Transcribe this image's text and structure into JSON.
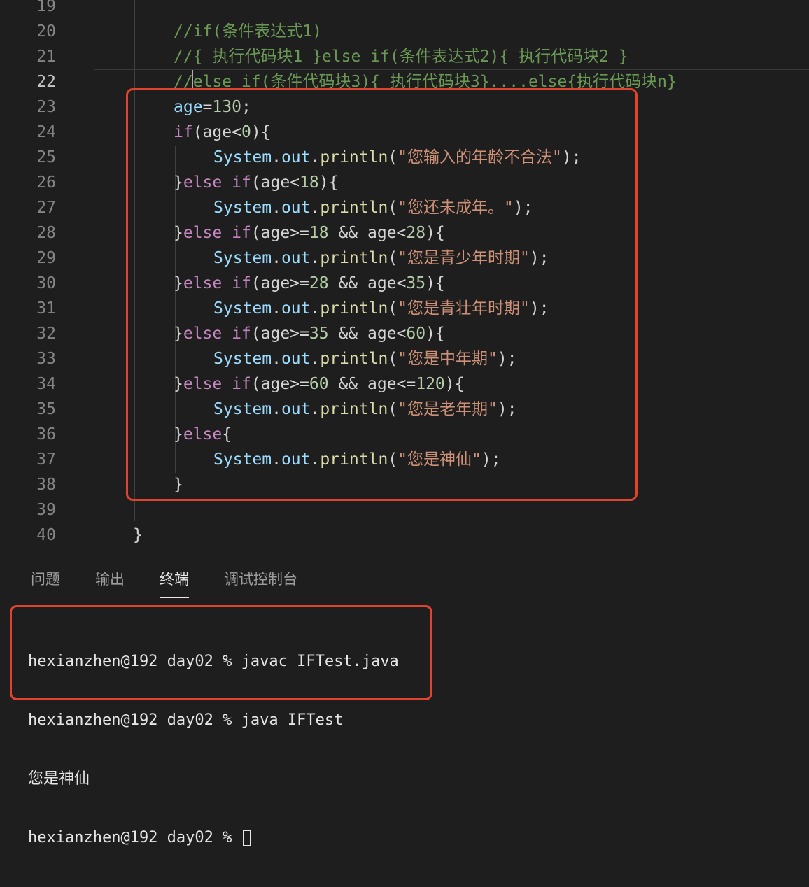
{
  "editor": {
    "lines": [
      {
        "num": "19",
        "segments": []
      },
      {
        "num": "20",
        "indent": 1,
        "segments": [
          {
            "t": "//if(条件表达式1)",
            "c": "cm"
          }
        ]
      },
      {
        "num": "21",
        "indent": 1,
        "segments": [
          {
            "t": "//{ 执行代码块1 }else if(条件表达式2){ 执行代码块2 }",
            "c": "cm"
          }
        ]
      },
      {
        "num": "22",
        "indent": 1,
        "current": true,
        "segments": [
          {
            "t": "//else if(条件代码块3){ 执行代码块3}....else{执行代码块n}",
            "c": "cm"
          }
        ]
      },
      {
        "num": "23",
        "indent": 1,
        "segments": [
          {
            "t": "age",
            "c": "var"
          },
          {
            "t": "=",
            "c": "op"
          },
          {
            "t": "130",
            "c": "num"
          },
          {
            "t": ";",
            "c": "op"
          }
        ]
      },
      {
        "num": "24",
        "indent": 1,
        "segments": [
          {
            "t": "if",
            "c": "kw"
          },
          {
            "t": "(age<",
            "c": "op"
          },
          {
            "t": "0",
            "c": "num"
          },
          {
            "t": "){",
            "c": "op"
          }
        ]
      },
      {
        "num": "25",
        "indent": 2,
        "segments": [
          {
            "t": "System",
            "c": "sys"
          },
          {
            "t": ".",
            "c": "op"
          },
          {
            "t": "out",
            "c": "sys"
          },
          {
            "t": ".",
            "c": "op"
          },
          {
            "t": "println",
            "c": "fn"
          },
          {
            "t": "(",
            "c": "op"
          },
          {
            "t": "\"您输入的年龄不合法\"",
            "c": "str"
          },
          {
            "t": ");",
            "c": "op"
          }
        ]
      },
      {
        "num": "26",
        "indent": 1,
        "segments": [
          {
            "t": "}",
            "c": "op"
          },
          {
            "t": "else if",
            "c": "kw"
          },
          {
            "t": "(age<",
            "c": "op"
          },
          {
            "t": "18",
            "c": "num"
          },
          {
            "t": "){",
            "c": "op"
          }
        ]
      },
      {
        "num": "27",
        "indent": 2,
        "segments": [
          {
            "t": "System",
            "c": "sys"
          },
          {
            "t": ".",
            "c": "op"
          },
          {
            "t": "out",
            "c": "sys"
          },
          {
            "t": ".",
            "c": "op"
          },
          {
            "t": "println",
            "c": "fn"
          },
          {
            "t": "(",
            "c": "op"
          },
          {
            "t": "\"您还未成年。\"",
            "c": "str"
          },
          {
            "t": ");",
            "c": "op"
          }
        ]
      },
      {
        "num": "28",
        "indent": 1,
        "segments": [
          {
            "t": "}",
            "c": "op"
          },
          {
            "t": "else if",
            "c": "kw"
          },
          {
            "t": "(age>=",
            "c": "op"
          },
          {
            "t": "18",
            "c": "num"
          },
          {
            "t": " && age<",
            "c": "op"
          },
          {
            "t": "28",
            "c": "num"
          },
          {
            "t": "){",
            "c": "op"
          }
        ]
      },
      {
        "num": "29",
        "indent": 2,
        "segments": [
          {
            "t": "System",
            "c": "sys"
          },
          {
            "t": ".",
            "c": "op"
          },
          {
            "t": "out",
            "c": "sys"
          },
          {
            "t": ".",
            "c": "op"
          },
          {
            "t": "println",
            "c": "fn"
          },
          {
            "t": "(",
            "c": "op"
          },
          {
            "t": "\"您是青少年时期\"",
            "c": "str"
          },
          {
            "t": ");",
            "c": "op"
          }
        ]
      },
      {
        "num": "30",
        "indent": 1,
        "segments": [
          {
            "t": "}",
            "c": "op"
          },
          {
            "t": "else if",
            "c": "kw"
          },
          {
            "t": "(age>=",
            "c": "op"
          },
          {
            "t": "28",
            "c": "num"
          },
          {
            "t": " && age<",
            "c": "op"
          },
          {
            "t": "35",
            "c": "num"
          },
          {
            "t": "){",
            "c": "op"
          }
        ]
      },
      {
        "num": "31",
        "indent": 2,
        "segments": [
          {
            "t": "System",
            "c": "sys"
          },
          {
            "t": ".",
            "c": "op"
          },
          {
            "t": "out",
            "c": "sys"
          },
          {
            "t": ".",
            "c": "op"
          },
          {
            "t": "println",
            "c": "fn"
          },
          {
            "t": "(",
            "c": "op"
          },
          {
            "t": "\"您是青壮年时期\"",
            "c": "str"
          },
          {
            "t": ");",
            "c": "op"
          }
        ]
      },
      {
        "num": "32",
        "indent": 1,
        "segments": [
          {
            "t": "}",
            "c": "op"
          },
          {
            "t": "else if",
            "c": "kw"
          },
          {
            "t": "(age>=",
            "c": "op"
          },
          {
            "t": "35",
            "c": "num"
          },
          {
            "t": " && age<",
            "c": "op"
          },
          {
            "t": "60",
            "c": "num"
          },
          {
            "t": "){",
            "c": "op"
          }
        ]
      },
      {
        "num": "33",
        "indent": 2,
        "segments": [
          {
            "t": "System",
            "c": "sys"
          },
          {
            "t": ".",
            "c": "op"
          },
          {
            "t": "out",
            "c": "sys"
          },
          {
            "t": ".",
            "c": "op"
          },
          {
            "t": "println",
            "c": "fn"
          },
          {
            "t": "(",
            "c": "op"
          },
          {
            "t": "\"您是中年期\"",
            "c": "str"
          },
          {
            "t": ");",
            "c": "op"
          }
        ]
      },
      {
        "num": "34",
        "indent": 1,
        "segments": [
          {
            "t": "}",
            "c": "op"
          },
          {
            "t": "else if",
            "c": "kw"
          },
          {
            "t": "(age>=",
            "c": "op"
          },
          {
            "t": "60",
            "c": "num"
          },
          {
            "t": " && age<=",
            "c": "op"
          },
          {
            "t": "120",
            "c": "num"
          },
          {
            "t": "){",
            "c": "op"
          }
        ]
      },
      {
        "num": "35",
        "indent": 2,
        "segments": [
          {
            "t": "System",
            "c": "sys"
          },
          {
            "t": ".",
            "c": "op"
          },
          {
            "t": "out",
            "c": "sys"
          },
          {
            "t": ".",
            "c": "op"
          },
          {
            "t": "println",
            "c": "fn"
          },
          {
            "t": "(",
            "c": "op"
          },
          {
            "t": "\"您是老年期\"",
            "c": "str"
          },
          {
            "t": ");",
            "c": "op"
          }
        ]
      },
      {
        "num": "36",
        "indent": 1,
        "segments": [
          {
            "t": "}",
            "c": "op"
          },
          {
            "t": "else",
            "c": "kw"
          },
          {
            "t": "{",
            "c": "op"
          }
        ]
      },
      {
        "num": "37",
        "indent": 2,
        "segments": [
          {
            "t": "System",
            "c": "sys"
          },
          {
            "t": ".",
            "c": "op"
          },
          {
            "t": "out",
            "c": "sys"
          },
          {
            "t": ".",
            "c": "op"
          },
          {
            "t": "println",
            "c": "fn"
          },
          {
            "t": "(",
            "c": "op"
          },
          {
            "t": "\"您是神仙\"",
            "c": "str"
          },
          {
            "t": ");",
            "c": "op"
          }
        ]
      },
      {
        "num": "38",
        "indent": 1,
        "segments": [
          {
            "t": "}",
            "c": "op"
          }
        ]
      },
      {
        "num": "39",
        "segments": []
      },
      {
        "num": "40",
        "indent": 0,
        "segments": [
          {
            "t": "}",
            "c": "op"
          }
        ]
      }
    ],
    "colors": {
      "comment": "#6a9955",
      "keyword": "#c586c0",
      "number": "#b5cea8",
      "string": "#ce9178",
      "variable": "#9cdcfe",
      "function": "#dcdcaa",
      "highlight_box": "#e0442e"
    }
  },
  "panel": {
    "tabs": [
      {
        "label": "问题",
        "active": false
      },
      {
        "label": "输出",
        "active": false
      },
      {
        "label": "终端",
        "active": true
      },
      {
        "label": "调试控制台",
        "active": false
      }
    ]
  },
  "terminal": {
    "lines": [
      "hexianzhen@192 day02 % javac IFTest.java",
      "hexianzhen@192 day02 % java IFTest",
      "您是神仙",
      "hexianzhen@192 day02 % "
    ]
  }
}
